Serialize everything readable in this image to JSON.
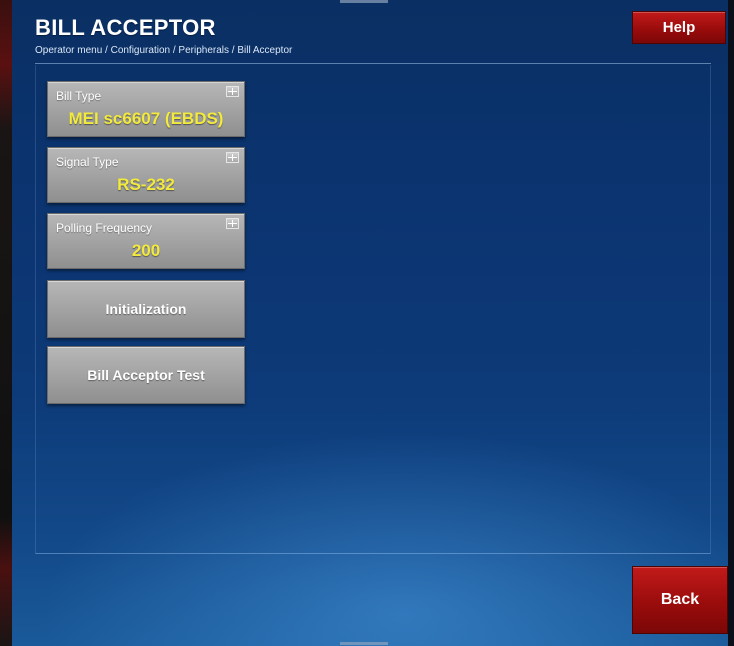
{
  "header": {
    "title": "BILL ACCEPTOR",
    "breadcrumb": "Operator menu / Configuration / Peripherals / Bill Acceptor",
    "help_label": "Help"
  },
  "settings": [
    {
      "label": "Bill Type",
      "value": "MEI sc6607 (EBDS)",
      "icon": "edit-icon"
    },
    {
      "label": "Signal Type",
      "value": "RS-232",
      "icon": "edit-icon"
    },
    {
      "label": "Polling Frequency",
      "value": "200",
      "icon": "edit-icon"
    }
  ],
  "actions": [
    {
      "label": "Initialization"
    },
    {
      "label": "Bill Acceptor Test"
    }
  ],
  "footer": {
    "back_label": "Back"
  },
  "colors": {
    "background": "#0b3470",
    "accent_red": "#9a0c0c",
    "value_yellow": "#f2ea3c",
    "button_gray": "#a5a5a5"
  }
}
